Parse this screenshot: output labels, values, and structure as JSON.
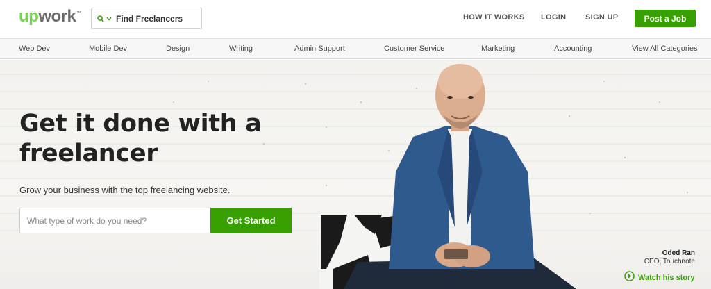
{
  "header": {
    "logo": {
      "part1": "up",
      "part2": "work",
      "tm": "™"
    },
    "search": {
      "label": "Find Freelancers",
      "icon": "search-icon",
      "caret_icon": "chevron-down-icon"
    },
    "nav": {
      "how_it_works": "HOW IT WORKS",
      "login": "LOGIN",
      "signup": "SIGN UP",
      "post_job": "Post a Job"
    }
  },
  "categories": [
    "Web Dev",
    "Mobile Dev",
    "Design",
    "Writing",
    "Admin Support",
    "Customer Service",
    "Marketing",
    "Accounting",
    "View All Categories"
  ],
  "hero": {
    "headline_line1": "Get it done with a",
    "headline_line2": "freelancer",
    "subline": "Grow your business with the top freelancing website.",
    "input_placeholder": "What type of work do you need?",
    "cta": "Get Started",
    "caption_name": "Oded Ran",
    "caption_role": "CEO, Touchnote",
    "watch_story": "Watch his story",
    "watch_icon": "play-circle-icon"
  },
  "colors": {
    "brand_green": "#37a000",
    "logo_green": "#6fda44",
    "logo_gray": "#6b6b6b"
  }
}
